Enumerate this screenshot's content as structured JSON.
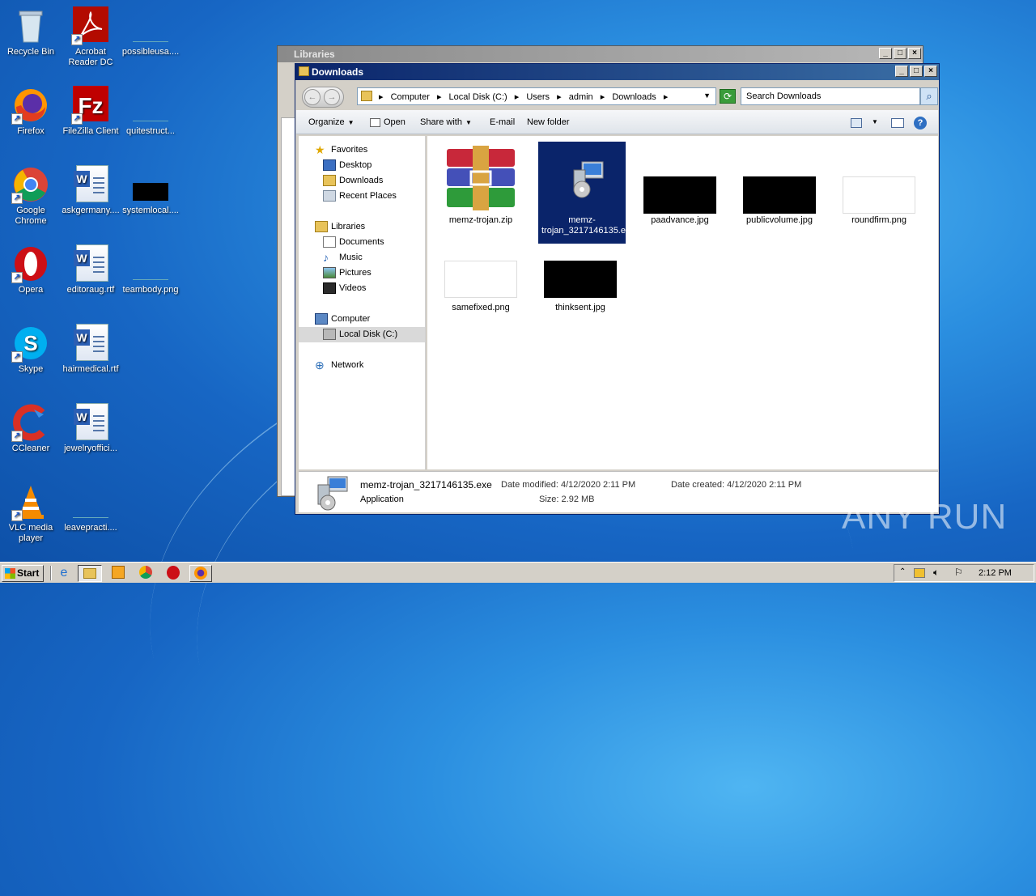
{
  "desktop": {
    "icons": [
      {
        "label": "Recycle Bin",
        "icon": "recycle-bin-icon"
      },
      {
        "label": "Acrobat Reader DC",
        "icon": "acrobat-icon"
      },
      {
        "label": "possibleusa....",
        "icon": "file-icon"
      },
      {
        "label": "Firefox",
        "icon": "firefox-icon"
      },
      {
        "label": "FileZilla Client",
        "icon": "filezilla-icon"
      },
      {
        "label": "quitestruct...",
        "icon": "file-icon"
      },
      {
        "label": "Google Chrome",
        "icon": "chrome-icon"
      },
      {
        "label": "askgermany....",
        "icon": "word-doc-icon"
      },
      {
        "label": "systemlocal....",
        "icon": "image-icon"
      },
      {
        "label": "Opera",
        "icon": "opera-icon"
      },
      {
        "label": "editoraug.rtf",
        "icon": "word-doc-icon"
      },
      {
        "label": "teambody.png",
        "icon": "image-icon"
      },
      {
        "label": "Skype",
        "icon": "skype-icon"
      },
      {
        "label": "hairmedical.rtf",
        "icon": "word-doc-icon"
      },
      {
        "label": "CCleaner",
        "icon": "ccleaner-icon"
      },
      {
        "label": "jewelryoffici...",
        "icon": "word-doc-icon"
      },
      {
        "label": "VLC media player",
        "icon": "vlc-icon"
      },
      {
        "label": "leavepracti....",
        "icon": "file-icon"
      }
    ]
  },
  "libraries_window": {
    "title": "Libraries",
    "min": "_",
    "max": "□",
    "close": "×"
  },
  "explorer": {
    "title": "Downloads",
    "min": "_",
    "max": "□",
    "close": "×",
    "breadcrumb": [
      "Computer",
      "Local Disk (C:)",
      "Users",
      "admin",
      "Downloads"
    ],
    "search_placeholder": "Search Downloads",
    "toolbar": {
      "organize": "Organize",
      "open": "Open",
      "share": "Share with",
      "email": "E-mail",
      "new_folder": "New folder"
    },
    "nav": {
      "favorites": "Favorites",
      "desktop": "Desktop",
      "downloads": "Downloads",
      "recent": "Recent Places",
      "libraries": "Libraries",
      "documents": "Documents",
      "music": "Music",
      "pictures": "Pictures",
      "videos": "Videos",
      "computer": "Computer",
      "local_disk": "Local Disk (C:)",
      "network": "Network"
    },
    "files": [
      {
        "name": "memz-trojan.zip",
        "icon": "winrar-archive-icon"
      },
      {
        "name": "memz-trojan_3217146135.exe",
        "icon": "installer-exe-icon",
        "selected": true
      },
      {
        "name": "paadvance.jpg",
        "icon": "image-thumbnail"
      },
      {
        "name": "publicvolume.jpg",
        "icon": "image-thumbnail"
      },
      {
        "name": "roundfirm.png",
        "icon": "image-thumbnail"
      },
      {
        "name": "samefixed.png",
        "icon": "image-thumbnail"
      },
      {
        "name": "thinksent.jpg",
        "icon": "image-thumbnail"
      }
    ],
    "details": {
      "filename": "memz-trojan_3217146135.exe",
      "type": "Application",
      "modified_label": "Date modified:",
      "modified": "4/12/2020 2:11 PM",
      "size_label": "Size:",
      "size": "2.92 MB",
      "created_label": "Date created:",
      "created": "4/12/2020 2:11 PM"
    }
  },
  "taskbar": {
    "start": "Start",
    "time": "2:12 PM"
  },
  "watermark": "ANY RUN"
}
